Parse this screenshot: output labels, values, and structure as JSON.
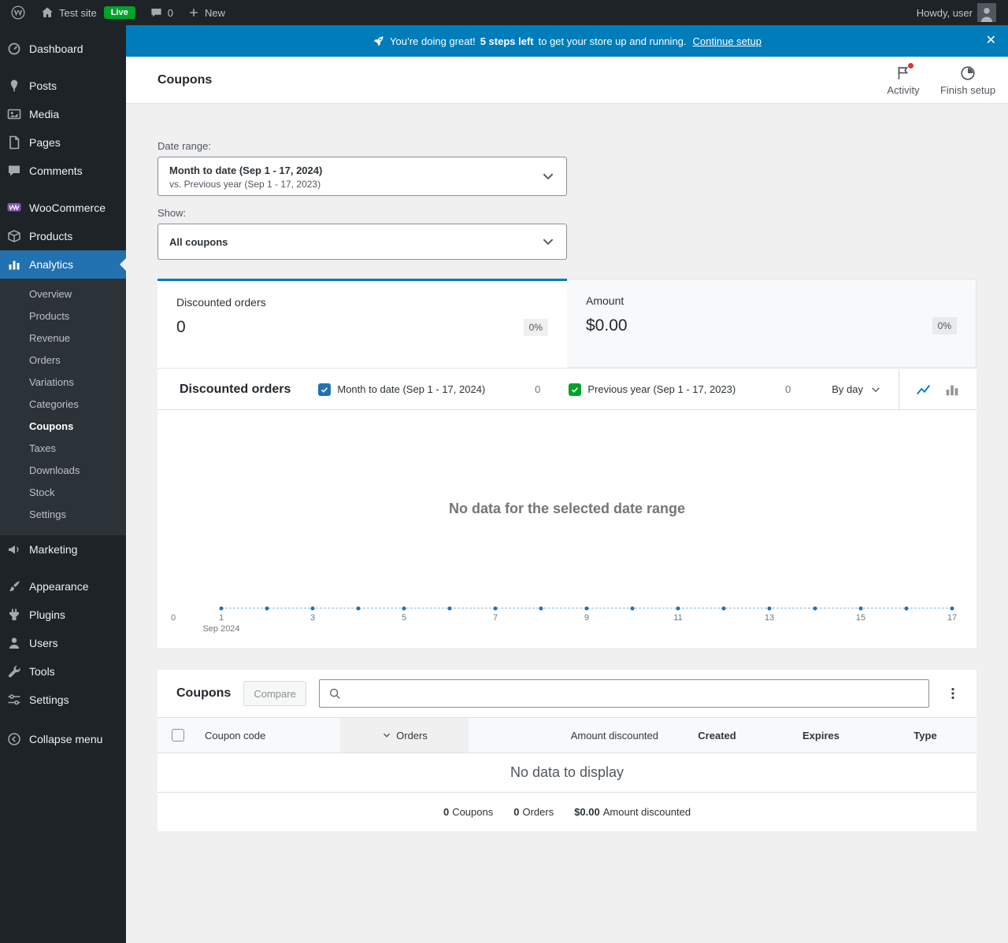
{
  "colors": {
    "banner_blue": "#007cba",
    "tile_accent": "#007cba",
    "series_primary": "#2271b1",
    "series_secondary": "#00a32a",
    "active_menu": "#2271b1",
    "live_green": "#00a32a",
    "notification_red": "#d63638"
  },
  "admin_bar": {
    "site_name": "Test site",
    "live_badge": "Live",
    "comment_count": "0",
    "new_label": "New",
    "howdy": "Howdy, user"
  },
  "sidebar": {
    "items": [
      {
        "label": "Dashboard"
      },
      {
        "label": "Posts"
      },
      {
        "label": "Media"
      },
      {
        "label": "Pages"
      },
      {
        "label": "Comments"
      },
      {
        "label": "WooCommerce"
      },
      {
        "label": "Products"
      },
      {
        "label": "Analytics"
      },
      {
        "label": "Marketing"
      },
      {
        "label": "Appearance"
      },
      {
        "label": "Plugins"
      },
      {
        "label": "Users"
      },
      {
        "label": "Tools"
      },
      {
        "label": "Settings"
      },
      {
        "label": "Collapse menu"
      }
    ],
    "analytics_submenu": [
      {
        "label": "Overview"
      },
      {
        "label": "Products"
      },
      {
        "label": "Revenue"
      },
      {
        "label": "Orders"
      },
      {
        "label": "Variations"
      },
      {
        "label": "Categories"
      },
      {
        "label": "Coupons"
      },
      {
        "label": "Taxes"
      },
      {
        "label": "Downloads"
      },
      {
        "label": "Stock"
      },
      {
        "label": "Settings"
      }
    ]
  },
  "banner": {
    "icon": "rocket-icon",
    "message": "You’re doing great!",
    "steps_left": "5 steps left",
    "message_tail": "to get your store up and running.",
    "cta": "Continue setup",
    "close": "✕"
  },
  "page_header": {
    "title": "Coupons",
    "activity": "Activity",
    "finish_setup": "Finish setup"
  },
  "filters": {
    "date_range_label": "Date range:",
    "date_range_value": "Month to date (Sep 1 - 17, 2024)",
    "date_range_compare": "vs. Previous year (Sep 1 - 17, 2023)",
    "show_label": "Show:",
    "show_value": "All coupons"
  },
  "summary_tiles": [
    {
      "label": "Discounted orders",
      "value": "0",
      "delta": "0%"
    },
    {
      "label": "Amount",
      "value": "$0.00",
      "delta": "0%"
    }
  ],
  "chart": {
    "title": "Discounted orders",
    "legend": [
      {
        "label": "Month to date (Sep 1 - 17, 2024)",
        "count": "0"
      },
      {
        "label": "Previous year (Sep 1 - 17, 2023)",
        "count": "0"
      }
    ],
    "interval": "By day",
    "empty_message": "No data for the selected date range",
    "y_zero": "0",
    "x_labels": [
      "1",
      "3",
      "5",
      "7",
      "9",
      "11",
      "13",
      "15",
      "17"
    ],
    "month_label": "Sep 2024"
  },
  "chart_data": {
    "type": "line",
    "title": "Discounted orders",
    "x": [
      1,
      2,
      3,
      4,
      5,
      6,
      7,
      8,
      9,
      10,
      11,
      12,
      13,
      14,
      15,
      16,
      17
    ],
    "series": [
      {
        "name": "Month to date (Sep 1 - 17, 2024)",
        "values": [
          0,
          0,
          0,
          0,
          0,
          0,
          0,
          0,
          0,
          0,
          0,
          0,
          0,
          0,
          0,
          0,
          0
        ]
      },
      {
        "name": "Previous year (Sep 1 - 17, 2023)",
        "values": [
          0,
          0,
          0,
          0,
          0,
          0,
          0,
          0,
          0,
          0,
          0,
          0,
          0,
          0,
          0,
          0,
          0
        ]
      }
    ],
    "xlabel": "Sep 2024",
    "ylabel": "",
    "ylim": [
      0,
      1
    ],
    "grid": false,
    "legend_position": "top"
  },
  "coupons_table": {
    "title": "Coupons",
    "compare": "Compare",
    "search_value": "",
    "columns": [
      {
        "label": "Coupon code"
      },
      {
        "label": "Orders",
        "sorted": "desc"
      },
      {
        "label": "Amount discounted"
      },
      {
        "label": "Created"
      },
      {
        "label": "Expires"
      },
      {
        "label": "Type"
      }
    ],
    "empty_message": "No data to display",
    "summary": [
      {
        "value": "0",
        "label": "Coupons"
      },
      {
        "value": "0",
        "label": "Orders"
      },
      {
        "value": "$0.00",
        "label": "Amount discounted"
      }
    ]
  }
}
